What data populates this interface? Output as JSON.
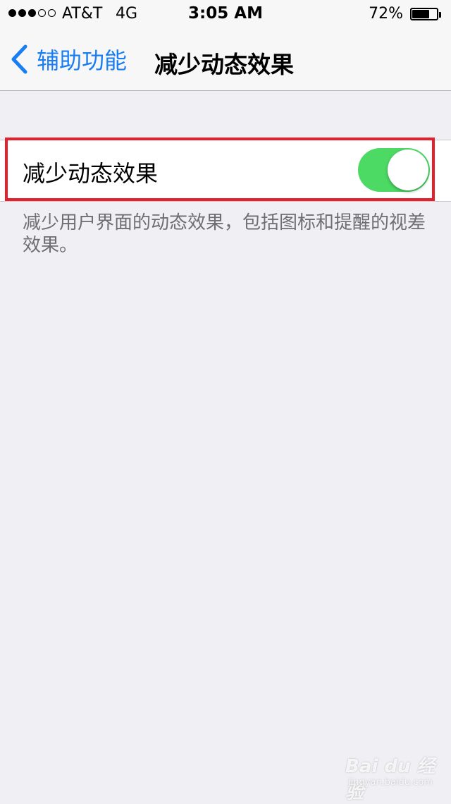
{
  "status_bar": {
    "signal_bars_filled": 3,
    "signal_bars_total": 5,
    "carrier": "AT&T",
    "network": "4G",
    "time": "3:05 AM",
    "battery_percent": "72%",
    "battery_level": 0.72
  },
  "nav": {
    "back_label": "辅助功能",
    "title": "减少动态效果"
  },
  "setting": {
    "label": "减少动态效果",
    "enabled": true,
    "footer": "减少用户界面的动态效果，包括图标和提醒的视差效果。"
  },
  "annotation": {
    "highlight_color": "#e5202a"
  },
  "watermark": {
    "logo": "Bai du 经验",
    "url": "jingyan.baidu.com"
  },
  "colors": {
    "accent": "#1a7ef3",
    "toggle_on": "#4cd964",
    "background": "#efeff4"
  }
}
